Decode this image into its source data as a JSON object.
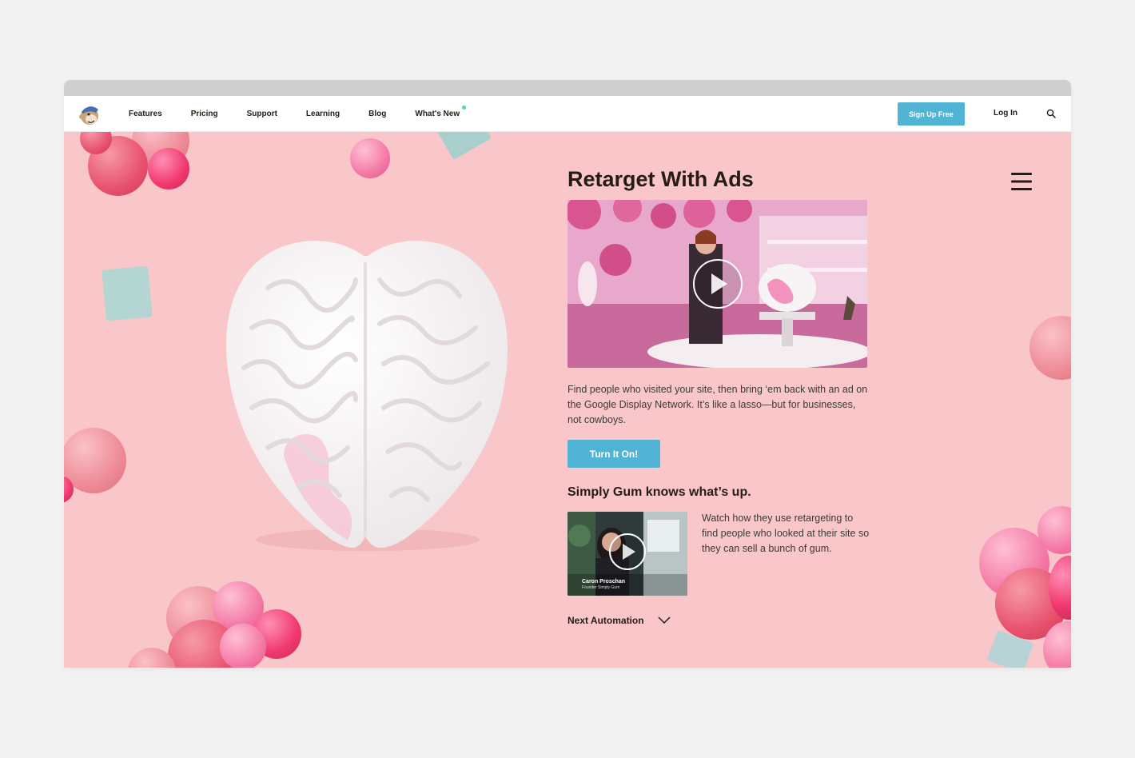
{
  "nav": {
    "links": [
      "Features",
      "Pricing",
      "Support",
      "Learning",
      "Blog",
      "What's New"
    ],
    "signup_label": "Sign Up Free",
    "login_label": "Log In"
  },
  "hero": {
    "title": "Retarget With Ads",
    "description": "Find people who visited your site, then bring ‘em back with an ad on the Google Display Network. It’s like a lasso—but for businesses, not cowboys.",
    "cta_label": "Turn It On!",
    "case_title": "Simply Gum knows what’s up.",
    "case_description": "Watch how they use retargeting to find people who looked at their site so they can sell a bunch of gum.",
    "video_caption_name": "Caron Proschan",
    "video_caption_role": "Founder Simply Gum",
    "next_label": "Next Automation"
  },
  "colors": {
    "accent": "#52b4d4",
    "hero_bg": "#f9c6c9",
    "new_dot": "#52d4b5"
  }
}
